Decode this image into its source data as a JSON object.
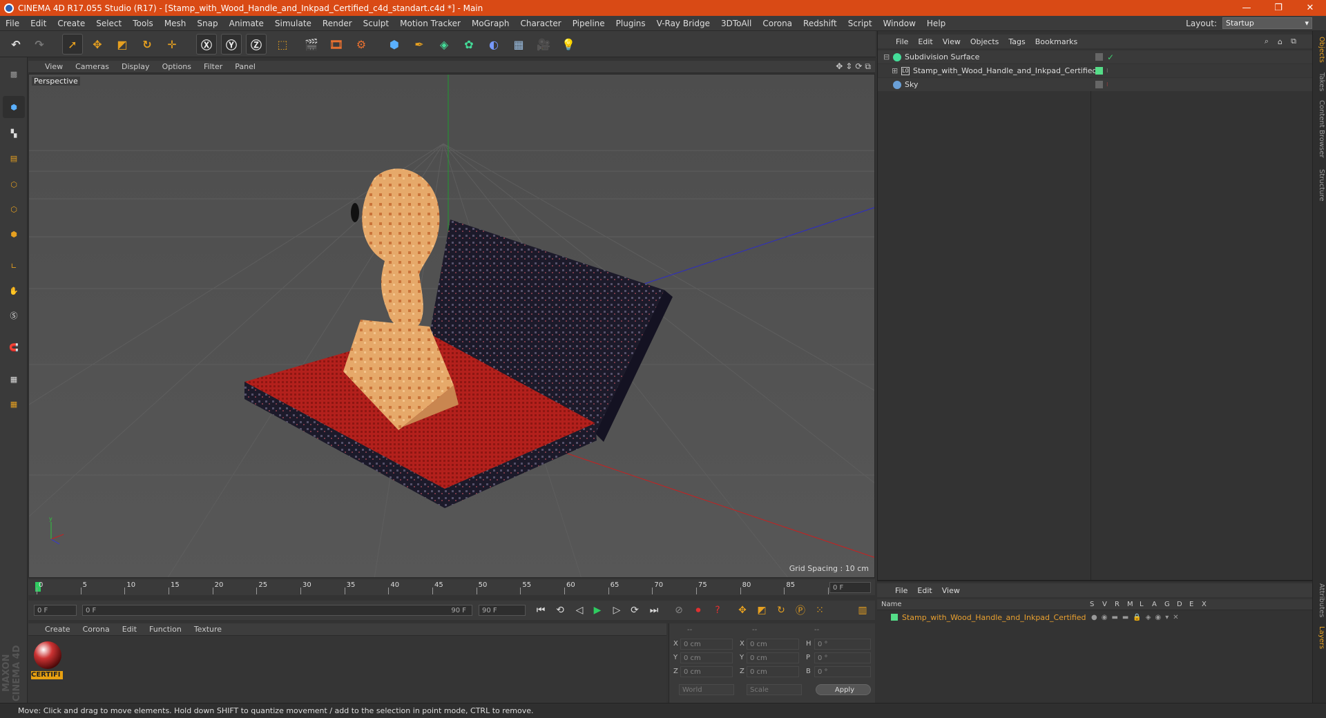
{
  "window": {
    "title": "CINEMA 4D R17.055 Studio (R17) - [Stamp_with_Wood_Handle_and_Inkpad_Certified_c4d_standart.c4d *] - Main",
    "minimize": "—",
    "restore": "❐",
    "close": "✕"
  },
  "menubar": [
    "File",
    "Edit",
    "Create",
    "Select",
    "Tools",
    "Mesh",
    "Snap",
    "Animate",
    "Simulate",
    "Render",
    "Sculpt",
    "Motion Tracker",
    "MoGraph",
    "Character",
    "Pipeline",
    "Plugins",
    "V-Ray Bridge",
    "3DToAll",
    "Corona",
    "Redshift",
    "Script",
    "Window",
    "Help"
  ],
  "layout": {
    "label": "Layout:",
    "value": "Startup"
  },
  "viewport": {
    "menu": [
      "View",
      "Cameras",
      "Display",
      "Options",
      "Filter",
      "Panel"
    ],
    "label": "Perspective",
    "grid_spacing": "Grid Spacing : 10 cm"
  },
  "timeline": {
    "ticks": [
      "0",
      "5",
      "10",
      "15",
      "20",
      "25",
      "30",
      "35",
      "40",
      "45",
      "50",
      "55",
      "60",
      "65",
      "70",
      "75",
      "80",
      "85",
      "90"
    ],
    "current_frame": "0 F",
    "start_frame": "0 F",
    "range_start": "0 F",
    "range_end": "90 F",
    "end_frame": "90 F"
  },
  "material_manager": {
    "menu": [
      "Create",
      "Corona",
      "Edit",
      "Function",
      "Texture"
    ],
    "material_name": "CERTIFI"
  },
  "coordinates": {
    "headers": [
      "--",
      "--",
      "--"
    ],
    "rows": [
      {
        "a": "X",
        "av": "0 cm",
        "b": "X",
        "bv": "0 cm",
        "c": "H",
        "cv": "0 °"
      },
      {
        "a": "Y",
        "av": "0 cm",
        "b": "Y",
        "bv": "0 cm",
        "c": "P",
        "cv": "0 °"
      },
      {
        "a": "Z",
        "av": "0 cm",
        "b": "Z",
        "bv": "0 cm",
        "c": "B",
        "cv": "0 °"
      }
    ],
    "space": "World",
    "mode": "Scale",
    "apply": "Apply"
  },
  "status": "Move: Click and drag to move elements. Hold down SHIFT to quantize movement / add to the selection in point mode, CTRL to remove.",
  "maxon": "MAXON CINEMA 4D",
  "object_manager": {
    "menu": [
      "File",
      "Edit",
      "View",
      "Objects",
      "Tags",
      "Bookmarks"
    ],
    "objects": [
      {
        "name": "Subdivision Surface",
        "indent": 0
      },
      {
        "name": "Stamp_with_Wood_Handle_and_Inkpad_Certified",
        "indent": 1
      },
      {
        "name": "Sky",
        "indent": 0
      }
    ]
  },
  "right_tabs": [
    "Objects",
    "Takes",
    "Content Browser",
    "Structure"
  ],
  "right_tabs_bottom": [
    "Attributes",
    "Layers"
  ],
  "layer_manager": {
    "menu": [
      "File",
      "Edit",
      "View"
    ],
    "headers": {
      "name": "Name",
      "cols": [
        "S",
        "V",
        "R",
        "M",
        "L",
        "A",
        "G",
        "D",
        "E",
        "X"
      ]
    },
    "layer": "Stamp_with_Wood_Handle_and_Inkpad_Certified"
  },
  "colors": {
    "titlebar": "#d94a15",
    "accent": "#e8a030",
    "layer_green": "#55dd88"
  }
}
